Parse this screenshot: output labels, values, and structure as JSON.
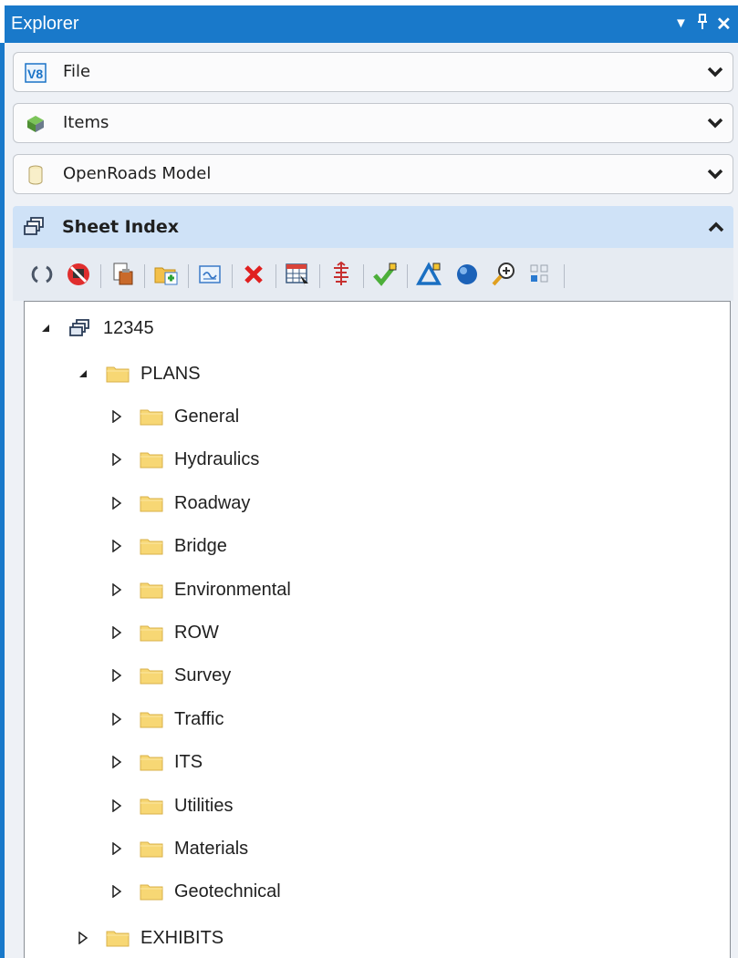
{
  "window": {
    "title": "Explorer",
    "controls": [
      "▼",
      "⊥",
      "✕"
    ]
  },
  "sections": [
    {
      "label": "File",
      "icon": "v8-file-icon",
      "state": "collapsed"
    },
    {
      "label": "Items",
      "icon": "items-icon",
      "state": "collapsed"
    },
    {
      "label": "OpenRoads Model",
      "icon": "model-icon",
      "state": "collapsed"
    },
    {
      "label": "Sheet Index",
      "icon": "sheet-index-icon",
      "state": "expanded"
    }
  ],
  "toolbar": {
    "tools": [
      "refresh-icon",
      "stop-icon",
      "sheet-properties-icon",
      "add-folder-icon",
      "add-sheet-icon",
      "delete-icon",
      "table-icon",
      "sort-icon",
      "check-icon",
      "delta-icon",
      "globe-icon",
      "zoom-icon",
      "grid-icon"
    ]
  },
  "tree": {
    "root": "12345",
    "plans": "PLANS",
    "children": [
      "General",
      "Hydraulics",
      "Roadway",
      "Bridge",
      "Environmental",
      "ROW",
      "Survey",
      "Traffic",
      "ITS",
      "Utilities",
      "Materials",
      "Geotechnical"
    ],
    "exhibits": "EXHIBITS"
  },
  "colors": {
    "titlebar": "#1979ca",
    "section_header_active": "#cfe2f7",
    "folder": "#f7d774"
  }
}
